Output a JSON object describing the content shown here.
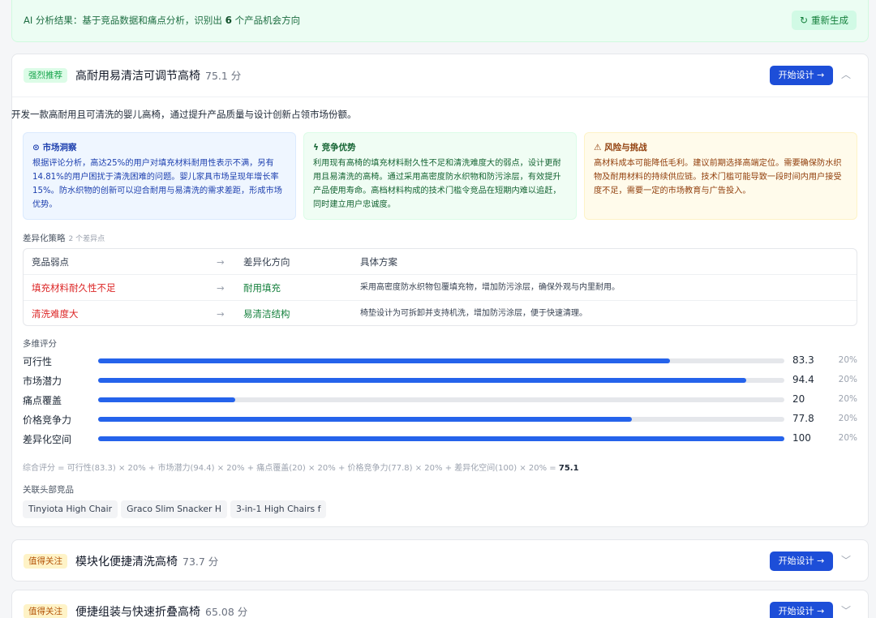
{
  "banner": {
    "text_prefix": "AI 分析结果：基于竞品数据和痛点分析，识别出 ",
    "count": "6",
    "text_suffix": " 个产品机会方向",
    "regen_icon": "refresh-icon",
    "regen_label": "重新生成"
  },
  "opportunities": [
    {
      "tag": "强烈推荐",
      "title": "高耐用易清洁可调节高椅",
      "score": "75.1 分",
      "design_label": "开始设计 →",
      "chevron_icon": "chevron-up-icon",
      "description": "开发一款高耐用且可清洗的婴儿高椅，通过提升产品质量与设计创新占领市场份额。",
      "insight": {
        "title": "⊙ 市场洞察",
        "text": "根据评论分析，高达25%的用户对填充材料耐用性表示不满，另有14.81%的用户困扰于清洗困难的问题。婴儿家具市场呈现年增长率15%。防水织物的创新可以迎合耐用与易清洗的需求差距，形成市场优势。"
      },
      "advantage": {
        "title": "ϟ 竞争优势",
        "text": "利用现有高椅的填充材料耐久性不足和清洗难度大的弱点，设计更耐用且易清洗的高椅。通过采用高密度防水织物和防污涂层，有效提升产品使用寿命。高档材料构成的技术门槛令竞品在短期内难以追赶，同时建立用户忠诚度。"
      },
      "risk": {
        "title": "⚠ 风险与挑战",
        "text": "高材料成本可能降低毛利。建议前期选择高端定位。需要确保防水织物及耐用材料的持续供应链。技术门槛可能导致一段时间内用户接受度不足，需要一定的市场教育与广告投入。"
      },
      "strategy_label": "差异化策略",
      "strategy_count": "2 个差异点",
      "table_headers": [
        "竞品弱点",
        "→",
        "差异化方向",
        "具体方案"
      ],
      "table_rows": [
        {
          "weakness": "填充材料耐久性不足",
          "arrow": "→",
          "direction": "耐用填充",
          "plan": "采用高密度防水织物包覆填充物，增加防污涂层，确保外观与内里耐用。"
        },
        {
          "weakness": "清洗难度大",
          "arrow": "→",
          "direction": "易清洁结构",
          "plan": "椅垫设计为可拆卸并支持机洗，增加防污涂层，便于快速清理。"
        }
      ],
      "scores_label": "多维评分",
      "scores": [
        {
          "name": "可行性",
          "value": 83.3,
          "display": "83.3",
          "weight": "20%"
        },
        {
          "name": "市场潜力",
          "value": 94.4,
          "display": "94.4",
          "weight": "20%"
        },
        {
          "name": "痛点覆盖",
          "value": 20,
          "display": "20",
          "weight": "20%"
        },
        {
          "name": "价格竞争力",
          "value": 77.8,
          "display": "77.8",
          "weight": "20%"
        },
        {
          "name": "差异化空间",
          "value": 100,
          "display": "100",
          "weight": "20%"
        }
      ],
      "formula_text": "综合评分 = 可行性(83.3) × 20% + 市场潜力(94.4) × 20% + 痛点覆盖(20) × 20% + 价格竞争力(77.8) × 20% + 差异化空间(100) × 20% = ",
      "formula_result": "75.1",
      "competitors_label": "关联头部竞品",
      "competitors": [
        "Tinyiota High Chair",
        "Graco Slim Snacker H",
        "3-in-1 High Chairs f"
      ]
    },
    {
      "tag": "值得关注",
      "title": "模块化便捷清洗高椅",
      "score": "73.7 分",
      "design_label": "开始设计 →",
      "chevron_icon": "chevron-down-icon"
    },
    {
      "tag": "值得关注",
      "title": "便捷组装与快速折叠高椅",
      "score": "65.08 分",
      "design_label": "开始设计 →",
      "chevron_icon": "chevron-down-icon"
    }
  ],
  "colors": {
    "primary": "#1d4ed8",
    "bar_fill": "#2563eb",
    "tag_green": "#16a34a",
    "tag_yellow": "#b45309",
    "weakness_red": "#dc2626",
    "direction_green": "#15803d"
  }
}
